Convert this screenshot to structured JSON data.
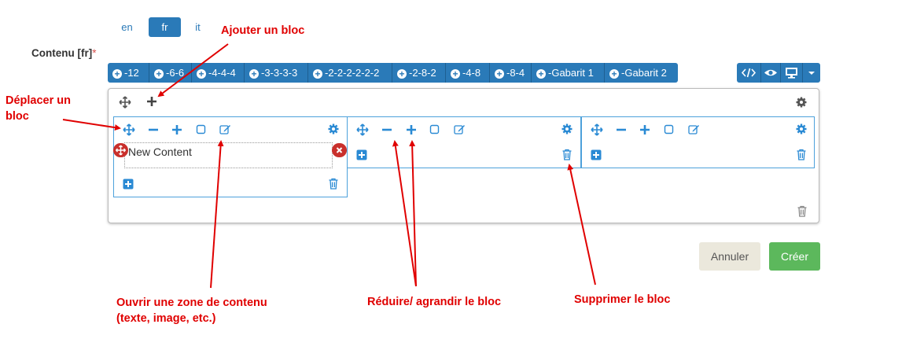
{
  "languages": {
    "en": "en",
    "fr": "fr",
    "it": "it"
  },
  "content_field": {
    "label": "Contenu [fr]",
    "required_mark": "*"
  },
  "layout_toolbar": {
    "buttons": [
      "-12",
      "-6-6",
      "-4-4-4",
      "-3-3-3-3",
      "-2-2-2-2-2-2",
      "-2-8-2",
      "-4-8",
      "-8-4",
      "-Gabarit 1",
      "-Gabarit 2"
    ],
    "view_icons": [
      "code-icon",
      "eye-icon",
      "desktop-icon",
      "caret-down-icon"
    ]
  },
  "editor": {
    "row_icons": [
      "move-icon",
      "plus-icon",
      "gear-icon"
    ],
    "column_icons": [
      "move-icon",
      "minus-icon",
      "plus-icon",
      "square-icon",
      "edit-icon",
      "gear-icon",
      "add-square-icon",
      "trash-icon"
    ],
    "content_block": {
      "text": "New Content"
    }
  },
  "actions": {
    "cancel": "Annuler",
    "create": "Créer"
  },
  "annotations": {
    "add_block": "Ajouter un bloc",
    "move_block_line1": "Déplacer un",
    "move_block_line2": "bloc",
    "open_content_line1": "Ouvrir une zone de contenu",
    "open_content_line2": "(texte, image, etc.)",
    "resize_block": "Réduire/ agrandir le bloc",
    "delete_block": "Supprimer le bloc"
  },
  "colors": {
    "primary": "#2a7ab8",
    "column_border": "#4da1db",
    "annotation_red": "#e00000",
    "content_block_red": "#c9302c",
    "success": "#5cb85c",
    "cancel_bg": "#ebe8dc"
  }
}
